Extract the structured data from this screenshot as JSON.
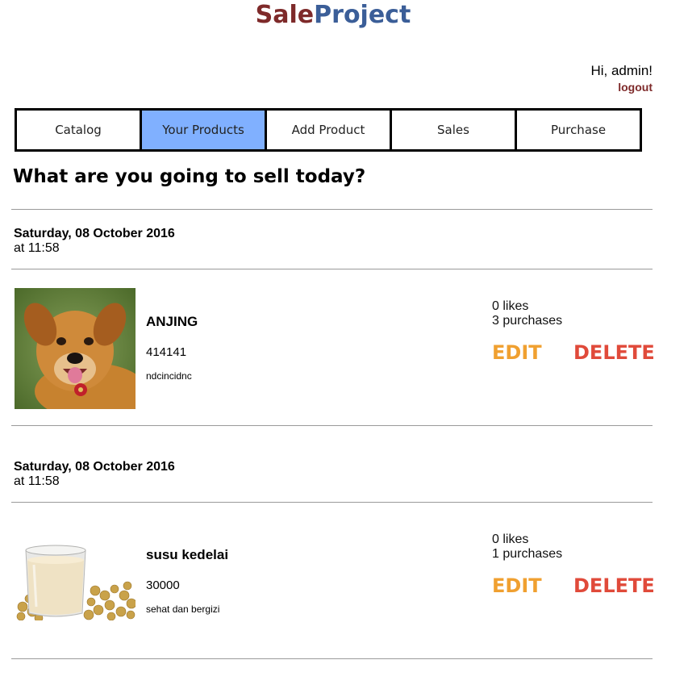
{
  "brand": {
    "part1": "Sale",
    "part2": "Project"
  },
  "user": {
    "greeting": "Hi, admin!",
    "logout": "logout"
  },
  "nav": {
    "items": [
      {
        "label": "Catalog"
      },
      {
        "label": "Your Products"
      },
      {
        "label": "Add Product"
      },
      {
        "label": "Sales"
      },
      {
        "label": "Purchase"
      }
    ],
    "active": "Your Products"
  },
  "page": {
    "heading": "What are you going to sell today?"
  },
  "products": [
    {
      "date": "Saturday, 08 October 2016",
      "time": "at 11:58",
      "name": "ANJING",
      "price": "414141",
      "description": "ndcincidnc",
      "likes": "0 likes",
      "purchases": "3 purchases",
      "edit": "EDIT",
      "delete": "DELETE",
      "image": "dog-photo"
    },
    {
      "date": "Saturday, 08 October 2016",
      "time": "at 11:58",
      "name": "susu kedelai",
      "price": "30000",
      "description": "sehat dan bergizi",
      "likes": "0 likes",
      "purchases": "1 purchases",
      "edit": "EDIT",
      "delete": "DELETE",
      "image": "soy-milk-photo"
    }
  ],
  "colors": {
    "brand_part1": "#7e2a2a",
    "brand_part2": "#3b5e98",
    "active_tab": "#80b0ff",
    "edit": "#f0a030",
    "delete": "#e04a3a"
  }
}
